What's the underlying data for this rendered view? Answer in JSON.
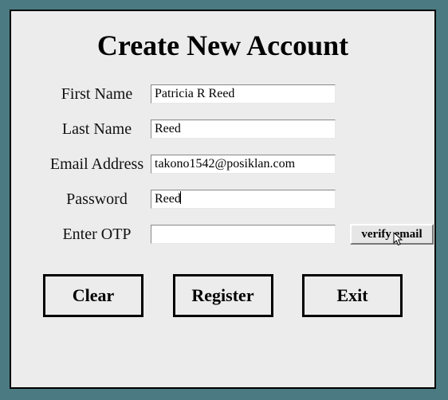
{
  "title": "Create New Account",
  "fields": {
    "first_name": {
      "label": "First Name",
      "value": "Patricia R Reed"
    },
    "last_name": {
      "label": "Last Name",
      "value": "Reed"
    },
    "email": {
      "label": "Email Address",
      "value": "takono1542@posiklan.com"
    },
    "password": {
      "label": "Password",
      "value": "Reed"
    },
    "otp": {
      "label": "Enter OTP",
      "value": ""
    }
  },
  "verify_button": "verify email",
  "buttons": {
    "clear": "Clear",
    "register": "Register",
    "exit": "Exit"
  }
}
